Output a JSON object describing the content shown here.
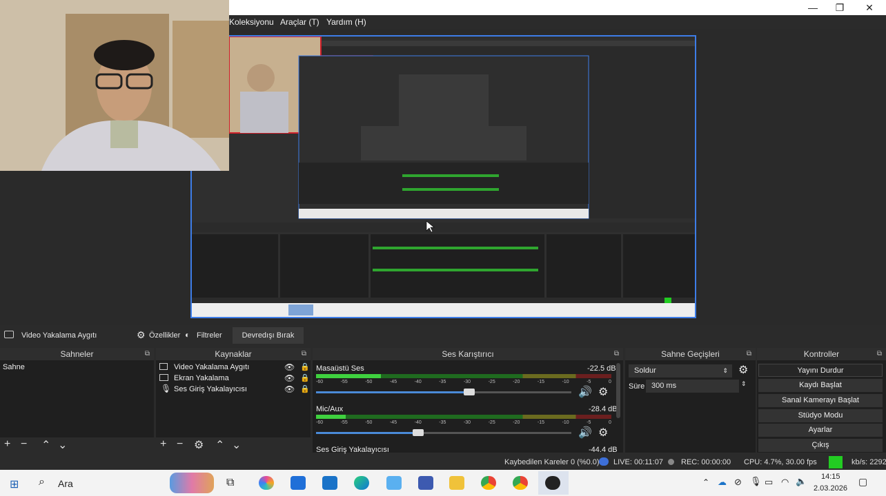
{
  "menu": {
    "collection": "Koleksiyonu",
    "tools": "Araçlar (T)",
    "help": "Yardım (H)"
  },
  "window_controls": {
    "minimize": "—",
    "maximize": "❐",
    "close": "✕"
  },
  "toolbar": {
    "source_name": "Video Yakalama Aygıtı",
    "properties": "Özellikler",
    "filters": "Filtreler",
    "deactivate": "Devredışı Bırak"
  },
  "scenes": {
    "title": "Sahneler",
    "items": [
      "Sahne"
    ]
  },
  "sources": {
    "title": "Kaynaklar",
    "items": [
      "Video Yakalama Aygıtı",
      "Ekran Yakalama",
      "Ses Giriş Yakalayıcısı"
    ]
  },
  "mixer": {
    "title": "Ses Karıştırıcı",
    "channels": [
      {
        "name": "Masaüstü Ses",
        "db": "-22.5 dB",
        "level": 0.22,
        "volume": 0.6
      },
      {
        "name": "Mic/Aux",
        "db": "-28.4 dB",
        "level": 0.1,
        "volume": 0.4
      },
      {
        "name": "Ses Giriş Yakalayıcısı",
        "db": "-44.4 dB"
      }
    ],
    "ticks": [
      "-60",
      "-55",
      "-50",
      "-45",
      "-40",
      "-35",
      "-30",
      "-25",
      "-20",
      "-15",
      "-10",
      "-5",
      "0"
    ]
  },
  "transitions": {
    "title": "Sahne Geçişleri",
    "selected": "Soldur",
    "duration_label": "Süre",
    "duration_value": "300 ms"
  },
  "controls": {
    "title": "Kontroller",
    "buttons": [
      "Yayını Durdur",
      "Kaydı Başlat",
      "Sanal Kamerayı Başlat",
      "Stüdyo Modu",
      "Ayarlar",
      "Çıkış"
    ]
  },
  "status": {
    "dropped": "Kaybedilen Kareler 0 (%0.0)",
    "live": "LIVE: 00:11:07",
    "rec": "REC: 00:00:00",
    "cpu": "CPU: 4.7%, 30.00 fps",
    "kbps": "kb/s: 2292"
  },
  "taskbar": {
    "search": "Ara",
    "time": "14:15",
    "date": "2.03.2026"
  },
  "colors": {
    "accent": "#3d7de8",
    "selection": "#d0202a",
    "meter_green": "#3fd13f",
    "status_green": "#22cc22"
  }
}
